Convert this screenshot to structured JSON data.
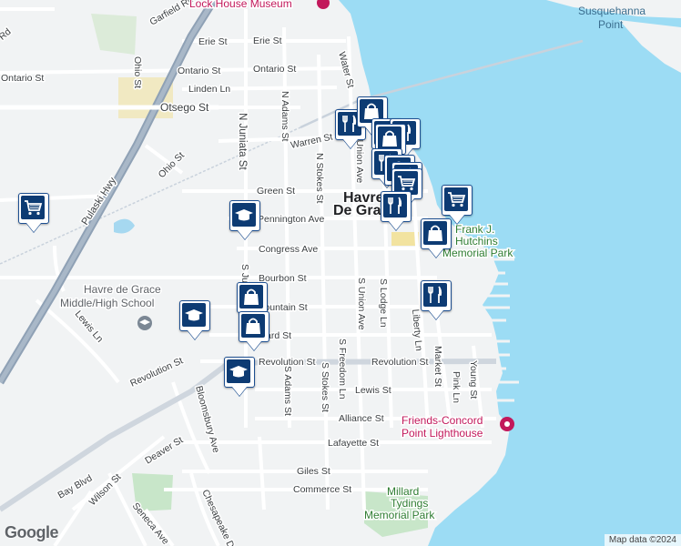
{
  "map": {
    "attribution": "Map data ©2024",
    "provider_logo": "Google",
    "colors": {
      "water": "#9cdcf4",
      "land": "#f1f3f4",
      "park": "#c8e6c9",
      "highway": "#a0aec0",
      "marker_fill": "#0d3b73",
      "marker_border": "#1d4f91"
    }
  },
  "places": {
    "museum": "Lock House Museum",
    "river": "Susquehanna",
    "river_2": "Point",
    "city_line1": "Havre",
    "city_line2": "De Grace",
    "school_line1": "Havre de Grace",
    "school_line2": "Middle/High School",
    "park_north_line1": "Frank J.",
    "park_north_line2": "Hutchins",
    "park_north_line3": "Memorial Park",
    "lighthouse_line1": "Friends-Concord",
    "lighthouse_line2": "Point Lighthouse",
    "park_south_line1": "Millard",
    "park_south_line2": "Tydings",
    "park_south_line3": "Memorial Park"
  },
  "streets": {
    "garfield": "Garfield Rd",
    "erie_w": "Erie St",
    "erie_e": "Erie St",
    "ontario_w": "Ontario St",
    "ontario_e": "Ontario St",
    "linden": "Linden Ln",
    "otsego": "Otsego St",
    "ohio_n": "Ohio St",
    "ohio_s": "Ohio St",
    "pulaski": "Pulaski Hwy",
    "juniata_n": "N Juniata St",
    "juniata_s": "S Juniata St",
    "adams_n": "N Adams St",
    "adams_s": "S Adams St",
    "stokes_n": "N Stokes St",
    "stokes_s": "S Stokes St",
    "water": "Water St",
    "warren": "Warren St",
    "union_n": "N Union Ave",
    "union_s": "S Union Ave",
    "green": "Green St",
    "pennington": "Pennington Ave",
    "congress": "Congress Ave",
    "bourbon": "Bourbon St",
    "fountain": "Fountain St",
    "girard": "Girard St",
    "revolution_w": "Revolution St",
    "revolution_m": "Revolution St",
    "revolution_e": "Revolution St",
    "lodge": "S Lodge Ln",
    "freedom": "S Freedom Ln",
    "market": "Market St",
    "pink": "Pink Ln",
    "young": "Young St",
    "liberty": "Liberty Ln",
    "lewis_w": "Lewis Ln",
    "lewis_e": "Lewis St",
    "alliance": "Alliance St",
    "lafayette": "Lafayette St",
    "giles": "Giles St",
    "commerce": "Commerce St",
    "bloomsbury": "Bloomsbury Ave",
    "deaver": "Deaver St",
    "wilson": "Wilson St",
    "seneca": "Seneca Ave",
    "chesapeake": "Chesapeake Dr",
    "bay": "Bay Blvd",
    "rd_nw": "Rd"
  },
  "markers": [
    {
      "name": "grocery",
      "icon": "cart-icon"
    },
    {
      "name": "school",
      "icon": "graduation-cap-icon"
    },
    {
      "name": "school",
      "icon": "graduation-cap-icon"
    },
    {
      "name": "school",
      "icon": "graduation-cap-icon"
    },
    {
      "name": "shopping",
      "icon": "shopping-bag-icon"
    },
    {
      "name": "shopping",
      "icon": "shopping-bag-icon"
    },
    {
      "name": "grocery",
      "icon": "cart-icon"
    },
    {
      "name": "restaurant",
      "icon": "fork-knife-icon"
    },
    {
      "name": "restaurant",
      "icon": "fork-knife-icon"
    },
    {
      "name": "shopping",
      "icon": "shopping-bag-icon"
    },
    {
      "name": "restaurant",
      "icon": "fork-knife-icon"
    },
    {
      "name": "restaurant",
      "icon": "fork-knife-icon"
    },
    {
      "name": "shopping",
      "icon": "shopping-bag-icon"
    },
    {
      "name": "restaurant",
      "icon": "fork-knife-icon"
    },
    {
      "name": "shopping",
      "icon": "shopping-bag-icon"
    },
    {
      "name": "restaurant",
      "icon": "fork-knife-icon"
    },
    {
      "name": "grocery",
      "icon": "cart-icon"
    },
    {
      "name": "shopping",
      "icon": "shopping-bag-icon"
    },
    {
      "name": "restaurant",
      "icon": "fork-knife-icon"
    }
  ]
}
